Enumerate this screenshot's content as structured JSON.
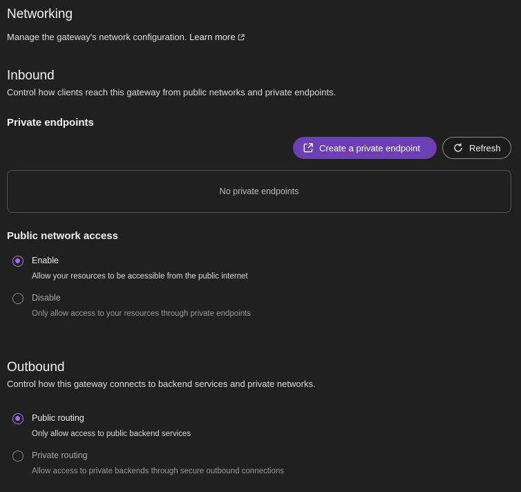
{
  "networking": {
    "title": "Networking",
    "description": "Manage the gateway's network configuration.",
    "learn_more": "Learn more"
  },
  "inbound": {
    "title": "Inbound",
    "description": "Control how clients reach this gateway from public networks and private endpoints.",
    "private_endpoints": {
      "title": "Private endpoints",
      "create_button": "Create a private endpoint",
      "refresh_button": "Refresh",
      "empty_text": "No private endpoints"
    },
    "public_network_access": {
      "title": "Public network access",
      "options": [
        {
          "label": "Enable",
          "description": "Allow your resources to be accessible from the public internet",
          "selected": true
        },
        {
          "label": "Disable",
          "description": "Only allow access to your resources through private endpoints",
          "selected": false
        }
      ]
    }
  },
  "outbound": {
    "title": "Outbound",
    "description": "Control how this gateway connects to backend services and private networks.",
    "options": [
      {
        "label": "Public routing",
        "description": "Only allow access to public backend services",
        "selected": true
      },
      {
        "label": "Private routing",
        "description": "Allow access to private backends through secure outbound connections",
        "selected": false
      }
    ]
  },
  "colors": {
    "accent": "#6c3fb3",
    "radio_selected": "#9d6cf0",
    "background": "#202020"
  }
}
